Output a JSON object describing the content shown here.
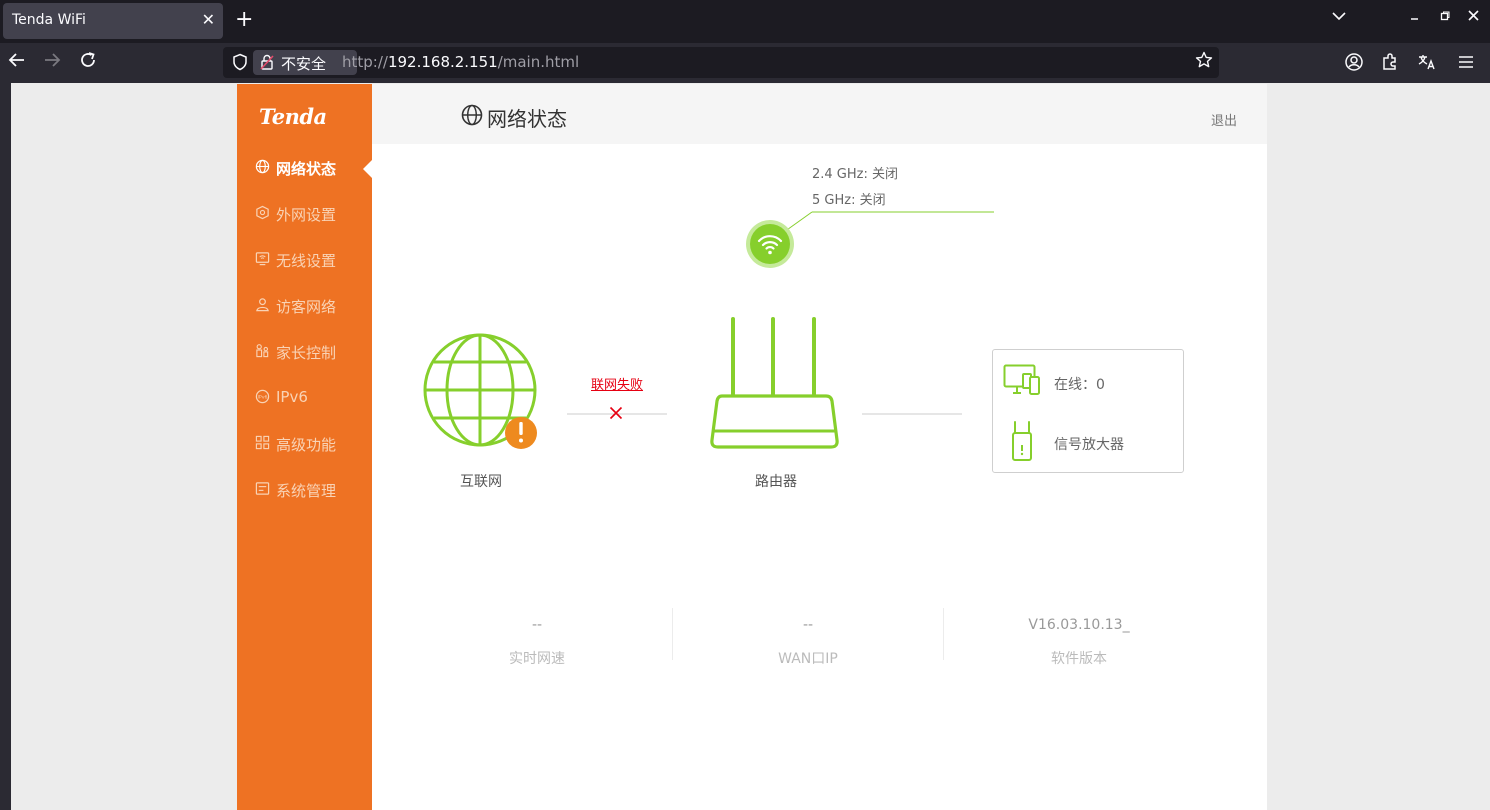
{
  "browser": {
    "tab_title": "Tenda WiFi",
    "tab_close": "✕",
    "new_tab": "+",
    "security_label": "不安全",
    "url_prefix": "http://",
    "url_host": "192.168.2.151",
    "url_path": "/main.html",
    "icons": [
      "back-icon",
      "forward-icon",
      "reload-icon",
      "shield-icon",
      "lock-icon",
      "star-icon",
      "account-icon",
      "extensions-icon",
      "translate-icon",
      "menu-icon"
    ]
  },
  "sidebar": {
    "logo": "Tenda",
    "items": [
      {
        "label": "网络状态",
        "icon": "globe-icon",
        "active": true
      },
      {
        "label": "外网设置",
        "icon": "hex-icon",
        "active": false
      },
      {
        "label": "无线设置",
        "icon": "wifi-box-icon",
        "active": false
      },
      {
        "label": "访客网络",
        "icon": "guest-icon",
        "active": false
      },
      {
        "label": "家长控制",
        "icon": "parent-icon",
        "active": false
      },
      {
        "label": "IPv6",
        "icon": "ipv6-icon",
        "active": false
      },
      {
        "label": "高级功能",
        "icon": "grid-icon",
        "active": false
      },
      {
        "label": "系统管理",
        "icon": "system-icon",
        "active": false
      }
    ]
  },
  "header": {
    "title": "网络状态",
    "logout": "退出"
  },
  "wifi": {
    "band_24": "2.4 GHz: 关闭",
    "band_5": "5 GHz: 关闭"
  },
  "topology": {
    "internet_label": "互联网",
    "connection_status": "联网失败",
    "router_label": "路由器",
    "online_label": "在线：0",
    "repeater_label": "信号放大器"
  },
  "stats": [
    {
      "value": "--",
      "label": "实时网速"
    },
    {
      "value": "--",
      "label": "WAN口IP"
    },
    {
      "value": "V16.03.10.13_",
      "label": "软件版本"
    }
  ],
  "colors": {
    "brand_orange": "#ee7223",
    "green": "#86cf2c",
    "error_red": "#e60012",
    "warning_orange": "#ee8a1f"
  }
}
